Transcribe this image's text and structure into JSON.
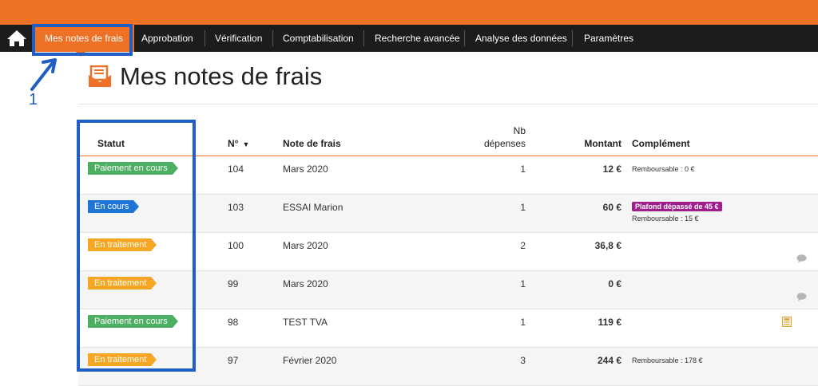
{
  "nav": {
    "items": [
      {
        "label": "Mes notes de frais",
        "active": true
      },
      {
        "label": "Approbation"
      },
      {
        "label": "Vérification"
      },
      {
        "label": "Comptabilisation"
      },
      {
        "label": "Recherche avancée"
      },
      {
        "label": "Analyse des données"
      },
      {
        "label": "Paramètres"
      }
    ]
  },
  "annotation": {
    "number": "1"
  },
  "page": {
    "title": "Mes notes de frais"
  },
  "table": {
    "headers": {
      "status": "Statut",
      "num": "N°",
      "name": "Note de frais",
      "nb_line1": "Nb",
      "nb_line2": "dépenses",
      "amount": "Montant",
      "complement": "Complément"
    },
    "sort_indicator": "▼",
    "rows": [
      {
        "status": "Paiement en cours",
        "status_color": "green",
        "num": "104",
        "name": "Mars 2020",
        "nb": "1",
        "amount": "12 €",
        "complement": "Remboursable : 0 €"
      },
      {
        "status": "En cours",
        "status_color": "blue",
        "num": "103",
        "name": "ESSAI Marion",
        "nb": "1",
        "amount": "60 €",
        "alert": "Plafond dépassé de 45 €",
        "complement": "Remboursable : 15 €"
      },
      {
        "status": "En traitement",
        "status_color": "orange",
        "num": "100",
        "name": "Mars 2020",
        "nb": "2",
        "amount": "36,8 €",
        "icon": "comment-icon"
      },
      {
        "status": "En traitement",
        "status_color": "orange",
        "num": "99",
        "name": "Mars 2020",
        "nb": "1",
        "amount": "0 €",
        "icon": "comment-icon"
      },
      {
        "status": "Paiement en cours",
        "status_color": "green",
        "num": "98",
        "name": "TEST TVA",
        "nb": "1",
        "amount": "119 €",
        "icon": "calculator-icon"
      },
      {
        "status": "En traitement",
        "status_color": "orange",
        "num": "97",
        "name": "Février 2020",
        "nb": "3",
        "amount": "244 €",
        "complement": "Remboursable : 178 €"
      }
    ]
  },
  "colors": {
    "brand": "#ef7125",
    "navbar": "#1c1c1c",
    "annotation": "#1f5fc4",
    "green": "#4caf62",
    "blue": "#1e75d6",
    "orange": "#f5a623",
    "alert": "#a11d8d"
  }
}
